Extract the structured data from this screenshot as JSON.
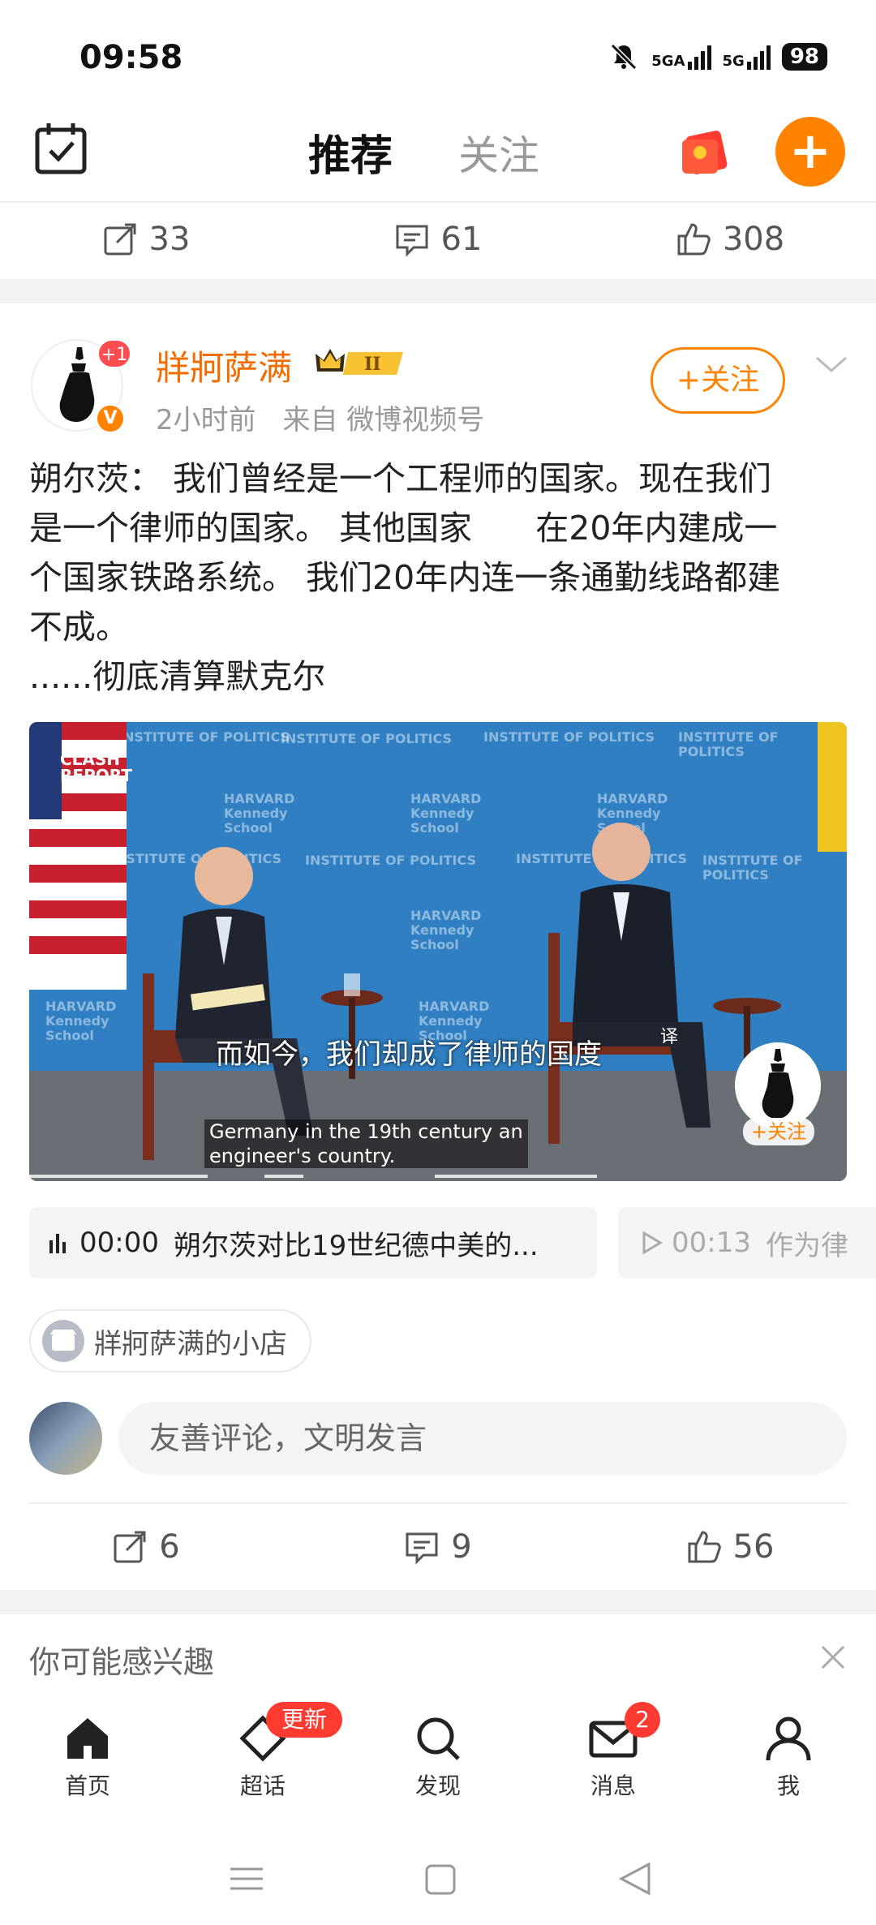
{
  "status_bar": {
    "time": "09:58",
    "net1": "5GA",
    "net2": "5G",
    "battery": "98"
  },
  "top_nav": {
    "tab_recommend": "推荐",
    "tab_following": "关注"
  },
  "prev_post_actions": {
    "reposts": "33",
    "comments": "61",
    "likes": "308"
  },
  "post": {
    "username": "牂牁萨满",
    "avatar_badge": "+1",
    "level": "II",
    "time": "2小时前",
    "source": "来自 微博视频号",
    "follow_label": "+关注",
    "text_lines": [
      "朔尔茨： 我们曾经是一个工程师的国家。现在我们",
      "是一个律师的国家。 其他国家      在20年内建成一",
      "个国家铁路系统。 我们20年内连一条通勤线路都建",
      "不成。",
      "......彻底清算默克尔"
    ],
    "video": {
      "watermark_line1": "CLASH",
      "watermark_line2": "REPORT",
      "backdrop_text_a": "HARVARD Kennedy School",
      "backdrop_text_b": "INSTITUTE OF POLITICS",
      "subtitle_cn": "而如今，我们却成了律师的国度",
      "translate_mark": "译",
      "subtitle_en_1": "Germany in the 19th century an",
      "subtitle_en_2": "engineer's country.",
      "follow_label": "+关注"
    },
    "chapters": [
      {
        "time": "00:00",
        "title": "朔尔茨对比19世纪德中美的..."
      },
      {
        "time": "00:13",
        "title": "作为律"
      }
    ],
    "shop_label": "牂牁萨满的小店",
    "comment_placeholder": "友善评论，文明发言",
    "actions": {
      "reposts": "6",
      "comments": "9",
      "likes": "56"
    }
  },
  "interest_label": "你可能感兴趣",
  "bottom_nav": {
    "home": "首页",
    "chaohua": "超话",
    "chaohua_badge": "更新",
    "discover": "发现",
    "messages": "消息",
    "messages_badge": "2",
    "me": "我"
  },
  "colors": {
    "accent": "#ff8200",
    "username": "#f06b00",
    "badge_red": "#ff3a30",
    "tab_underline": "#f7b500"
  }
}
